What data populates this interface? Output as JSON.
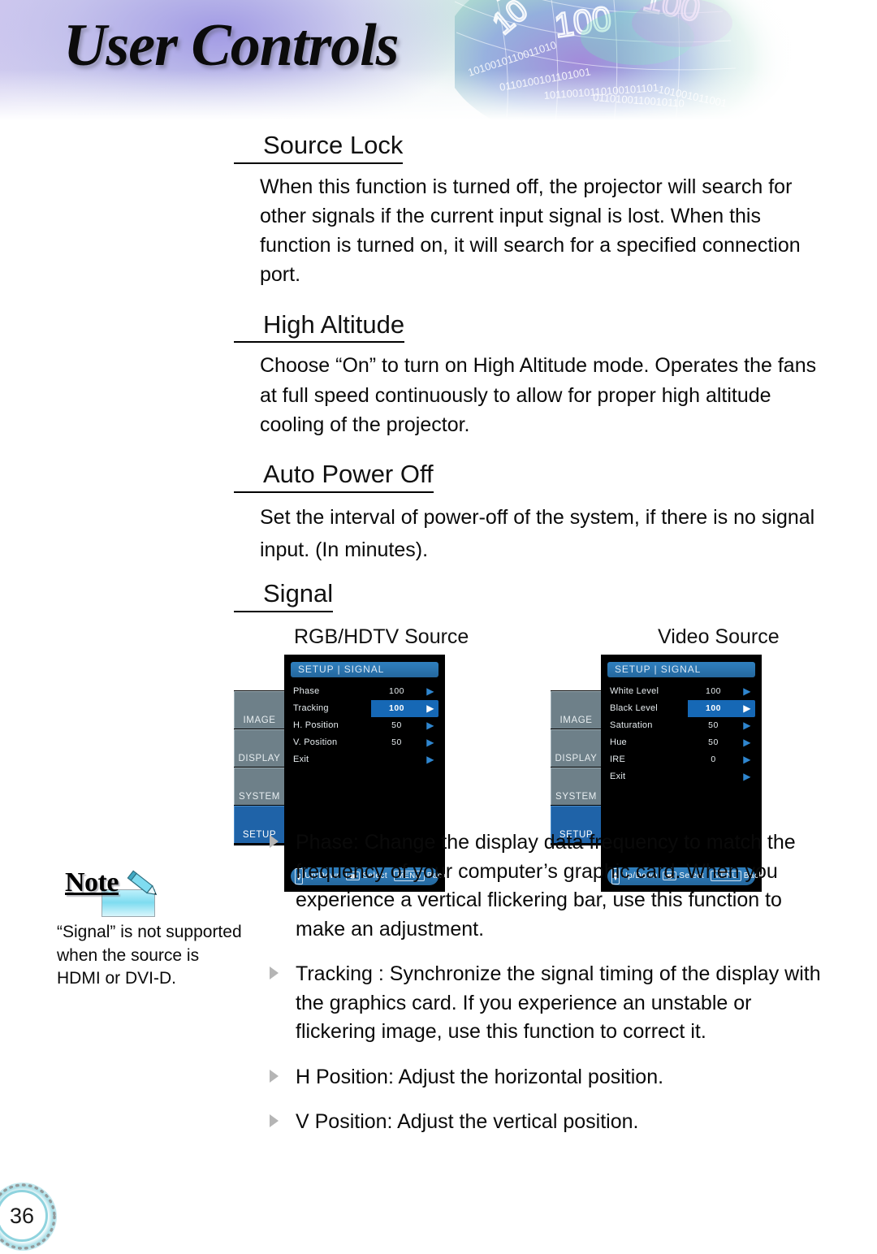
{
  "header": {
    "title": "User Controls",
    "art_name": "binary-sphere-graphic"
  },
  "sections": [
    {
      "heading": "Source Lock",
      "body": "When this function is turned off, the projector will search for other signals if the current input signal is lost. When this function is turned on, it will search for a specified connection port."
    },
    {
      "heading": "High Altitude",
      "body": "Choose “On” to turn on High Altitude mode. Operates the fans at full speed continuously to allow for proper high altitude cooling of the projector."
    },
    {
      "heading": "Auto Power Off",
      "body": "Set the interval of power-off of the system, if there is no signal input. (In minutes)."
    },
    {
      "heading": "Signal",
      "body": ""
    }
  ],
  "osd": {
    "left": {
      "source_label": "RGB/HDTV Source",
      "title": "SETUP | SIGNAL",
      "tabs": [
        {
          "label": "IMAGE",
          "active": false
        },
        {
          "label": "DISPLAY",
          "active": false
        },
        {
          "label": "SYSTEM",
          "active": false
        },
        {
          "label": "SETUP",
          "active": true
        }
      ],
      "rows": [
        {
          "label": "Phase",
          "value": "100",
          "highlighted": false
        },
        {
          "label": "Tracking",
          "value": "100",
          "highlighted": true
        },
        {
          "label": "H. Position",
          "value": "50",
          "highlighted": false
        },
        {
          "label": "V. Position",
          "value": "50",
          "highlighted": false
        },
        {
          "label": "Exit",
          "value": "",
          "highlighted": false
        }
      ],
      "help": {
        "updown": "Up/Down",
        "select": "Select",
        "menu": "MENU",
        "back": "Back"
      }
    },
    "right": {
      "source_label": "Video Source",
      "title": "SETUP | SIGNAL",
      "tabs": [
        {
          "label": "IMAGE",
          "active": false
        },
        {
          "label": "DISPLAY",
          "active": false
        },
        {
          "label": "SYSTEM",
          "active": false
        },
        {
          "label": "SETUP",
          "active": true
        }
      ],
      "rows": [
        {
          "label": "White Level",
          "value": "100",
          "highlighted": false
        },
        {
          "label": "Black Level",
          "value": "100",
          "highlighted": true
        },
        {
          "label": "Saturation",
          "value": "50",
          "highlighted": false
        },
        {
          "label": "Hue",
          "value": "50",
          "highlighted": false
        },
        {
          "label": "IRE",
          "value": "0",
          "highlighted": false
        },
        {
          "label": "Exit",
          "value": "",
          "highlighted": false
        }
      ],
      "help": {
        "updown": "Up/Down",
        "select": "Select",
        "menu": "MENU",
        "back": "Back"
      }
    }
  },
  "note": {
    "title": "Note",
    "text": "“Signal” is not supported when the source is HDMI or DVI-D."
  },
  "bullets": [
    "Phase: Change the display data frequency to match the frequency of your computer’s graphic card. When you experience a vertical flickering bar, use this function to make an adjustment.",
    "Tracking : Synchronize the signal timing of the display with the graphics card. If you experience an unstable or flickering image, use this function to correct it.",
    "H Position: Adjust the horizontal position.",
    "V Position: Adjust the vertical position."
  ],
  "footer": {
    "page_number": "36"
  },
  "colors": {
    "osd_title_blue": "#2a73ad",
    "osd_tab_inactive": "#6e8089",
    "osd_tab_active": "#1f63a8",
    "osd_highlight": "#1668b5",
    "osd_background": "#000000",
    "note_accent": "#7fdcf0",
    "page_ring": "#8fd3de"
  }
}
